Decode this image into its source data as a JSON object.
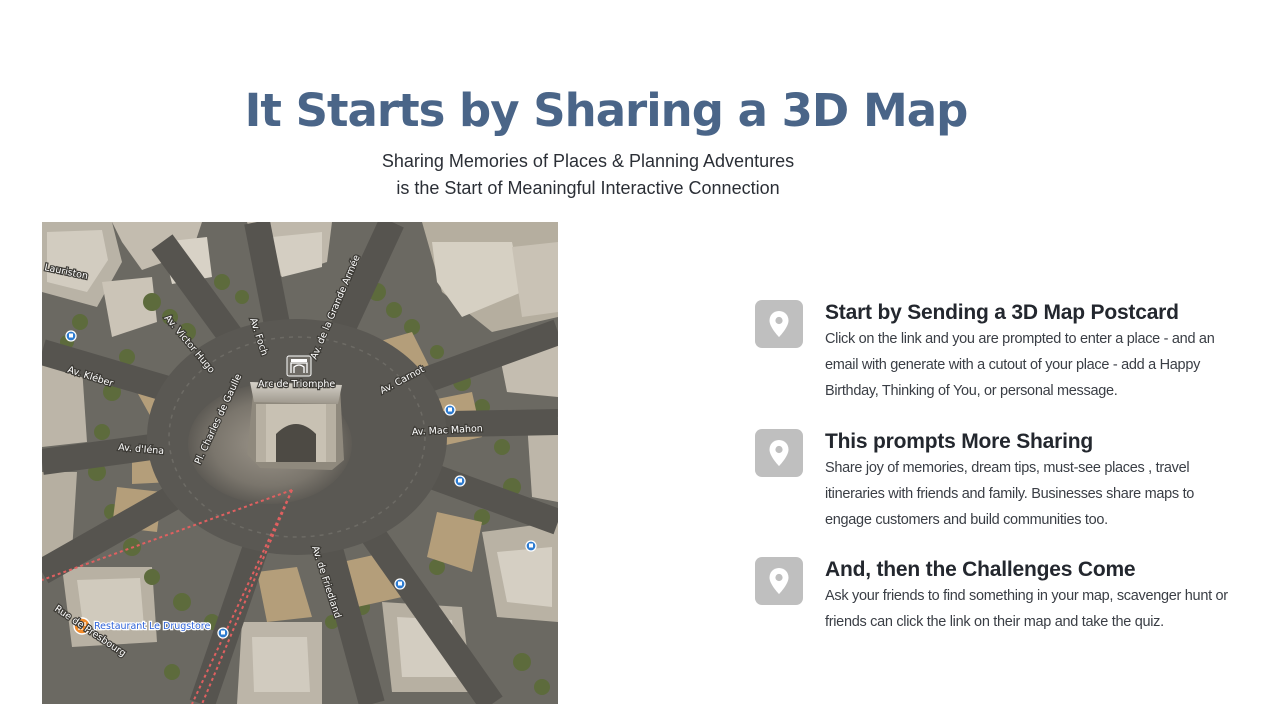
{
  "header": {
    "title": "It Starts by Sharing a 3D Map",
    "subtitle_line1": "Sharing Memories of Places & Planning Adventures",
    "subtitle_line2": "is the Start of Meaningful Interactive Connection"
  },
  "map": {
    "streets": {
      "lauriston": "Lauriston",
      "victor_hugo": "Av. Victor Hugo",
      "foch": "Av. Foch",
      "grande_armee": "Av. de la Grande Armée",
      "kleber": "Av. Kléber",
      "charles_de_gaulle": "Pl. Charles de Gaulle",
      "carnot": "Av. Carnot",
      "mac_mahon": "Av. Mac Mahon",
      "iena": "Av. d'Iéna",
      "friedland": "Av. de Friedland",
      "presbourg": "Rue de Presbourg"
    },
    "landmark": "Arc de Triomphe",
    "business": "Restaurant Le Drugstore"
  },
  "features": [
    {
      "icon": "map-pin-icon",
      "title": "Start by Sending a 3D Map Postcard",
      "body": "Click on the link and you are prompted to enter a place - and an email with generate with a cutout of your place - add a Happy Birthday, Thinking of You, or personal message."
    },
    {
      "icon": "map-pin-icon",
      "title": "This prompts More Sharing",
      "body": "Share joy of memories, dream tips, must-see places , travel itineraries with friends and family.  Businesses share maps to engage customers and build communities too."
    },
    {
      "icon": "map-pin-icon",
      "title": "And, then the Challenges Come",
      "body": "Ask your friends to find something in your map, scavenger hunt or friends can click the link on their map and take the quiz."
    }
  ],
  "colors": {
    "title": "#4a6588",
    "pin_box": "#bfbfbf",
    "text": "#23272e"
  }
}
